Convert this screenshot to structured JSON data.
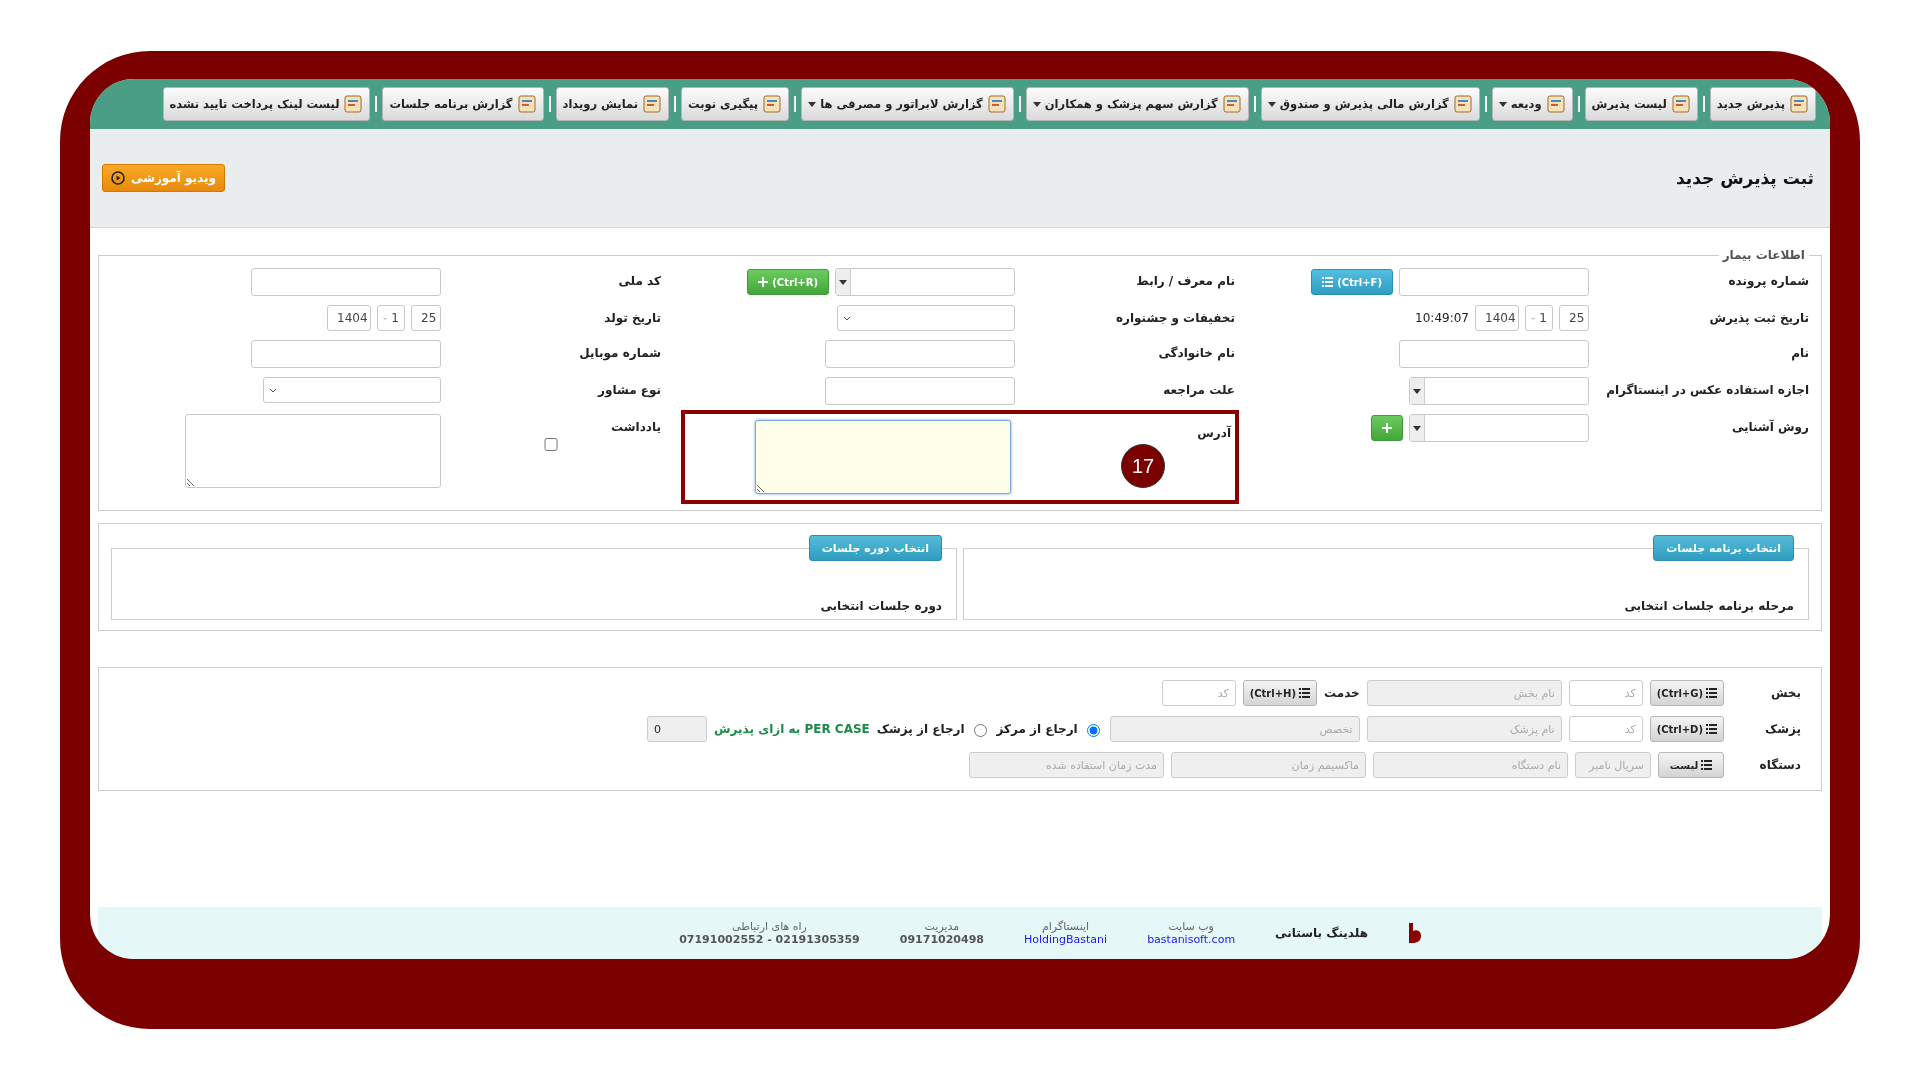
{
  "toolbar": [
    {
      "label": "پذیرش جدید",
      "has_menu": false
    },
    {
      "label": "لیست پذیرش",
      "has_menu": false
    },
    {
      "label": "ودیعه",
      "has_menu": true
    },
    {
      "label": "گزارش مالی پذیرش و صندوق",
      "has_menu": true
    },
    {
      "label": "گزارش سهم پزشک و همکاران",
      "has_menu": true
    },
    {
      "label": "گزارش لابراتور و مصرفی ها",
      "has_menu": true
    },
    {
      "label": "پیگیری نوبت",
      "has_menu": false
    },
    {
      "label": "نمایش رویداد",
      "has_menu": false
    },
    {
      "label": "گزارش برنامه جلسات",
      "has_menu": false
    },
    {
      "label": "لیست لینک پرداخت تایید نشده",
      "has_menu": false
    }
  ],
  "page_title": "ثبت پذیرش جدید",
  "video_button": "ویدیو آموزشی",
  "patient": {
    "legend": "اطلاعات بیمار",
    "fields": [
      {
        "label": "شماره پرونده",
        "kind": "input",
        "button": {
          "kind": "list",
          "label": "(Ctrl+F)"
        }
      },
      {
        "label": "نام معرف / رابط",
        "kind": "combo",
        "button": {
          "kind": "add",
          "label": "(Ctrl+R)"
        }
      },
      {
        "label": "کد ملی",
        "kind": "input"
      },
      {
        "label": "تاریخ ثبت پذیرش",
        "kind": "date",
        "date": [
          "25",
          "1",
          "1404"
        ],
        "time": "10:49:07"
      },
      {
        "label": "تخفیفات و جشنواره",
        "kind": "select"
      },
      {
        "label": "تاریخ تولد",
        "kind": "date",
        "date": [
          "25",
          "1",
          "1404"
        ]
      },
      {
        "label": "نام",
        "kind": "input"
      },
      {
        "label": "نام خانوادگی",
        "kind": "input"
      },
      {
        "label": "شماره موبایل",
        "kind": "input"
      },
      {
        "label": "اجازه استفاده عکس در اینستاگرام",
        "kind": "combo"
      },
      {
        "label": "علت مراجعه",
        "kind": "input"
      },
      {
        "label": "نوع مشاور",
        "kind": "select"
      },
      {
        "label": "روش آشنایی",
        "kind": "combo",
        "button": {
          "kind": "add"
        }
      },
      {
        "label": "آدرس",
        "kind": "textarea",
        "focused": true,
        "annotation": "17"
      },
      {
        "label": "یادداشت",
        "kind": "textarea",
        "focused": false,
        "checked": false
      }
    ]
  },
  "sessions": [
    {
      "button": "انتخاب برنامه جلسات",
      "text": "مرحله برنامه جلسات انتخابی"
    },
    {
      "button": "انتخاب دوره جلسات",
      "text": "دوره جلسات انتخابی"
    }
  ],
  "services": [
    {
      "label": "بخش",
      "items": [
        {
          "kind": "button",
          "label": "(Ctrl+G)"
        },
        {
          "kind": "short",
          "placeholder": "کد"
        },
        {
          "kind": "field",
          "placeholder": "نام بخش"
        },
        {
          "kind": "label",
          "label": "خدمت"
        },
        {
          "kind": "button",
          "label": "(Ctrl+H)"
        },
        {
          "kind": "short",
          "placeholder": "کد"
        }
      ]
    },
    {
      "label": "پزشک",
      "items": [
        {
          "kind": "button",
          "label": "(Ctrl+D)"
        },
        {
          "kind": "short",
          "placeholder": "کد"
        },
        {
          "kind": "field",
          "placeholder": "نام پزشک"
        },
        {
          "kind": "wide",
          "placeholder": "تخصص"
        },
        {
          "kind": "radio",
          "label": "ارجاع از مرکز",
          "selected": true
        },
        {
          "kind": "radio",
          "label": "ارجاع از پزشک",
          "selected": false
        },
        {
          "kind": "note",
          "label": "PER CASE به ازای پذیرش"
        },
        {
          "kind": "number",
          "value": "0"
        }
      ]
    },
    {
      "label": "دستگاه",
      "items": [
        {
          "kind": "button",
          "label": "لیست"
        },
        {
          "kind": "short",
          "placeholder": "سریال نامبر"
        },
        {
          "kind": "field",
          "placeholder": "نام دستگاه"
        },
        {
          "kind": "field",
          "placeholder": "ماکسیمم زمان"
        },
        {
          "kind": "field",
          "placeholder": "مدت زمان استفاده شده"
        }
      ]
    }
  ],
  "footer": {
    "brand": "هلدینگ باستانی",
    "columns": [
      {
        "title": "وب سایت",
        "value": "bastanisoft.com",
        "link": true
      },
      {
        "title": "اینستاگرام",
        "value": "HoldingBastani",
        "link": true
      },
      {
        "title": "مدیریت",
        "value": "09171020498",
        "link": false
      },
      {
        "title": "راه های ارتباطی",
        "value": "07191002552 - 02191305359",
        "link": false
      }
    ]
  }
}
